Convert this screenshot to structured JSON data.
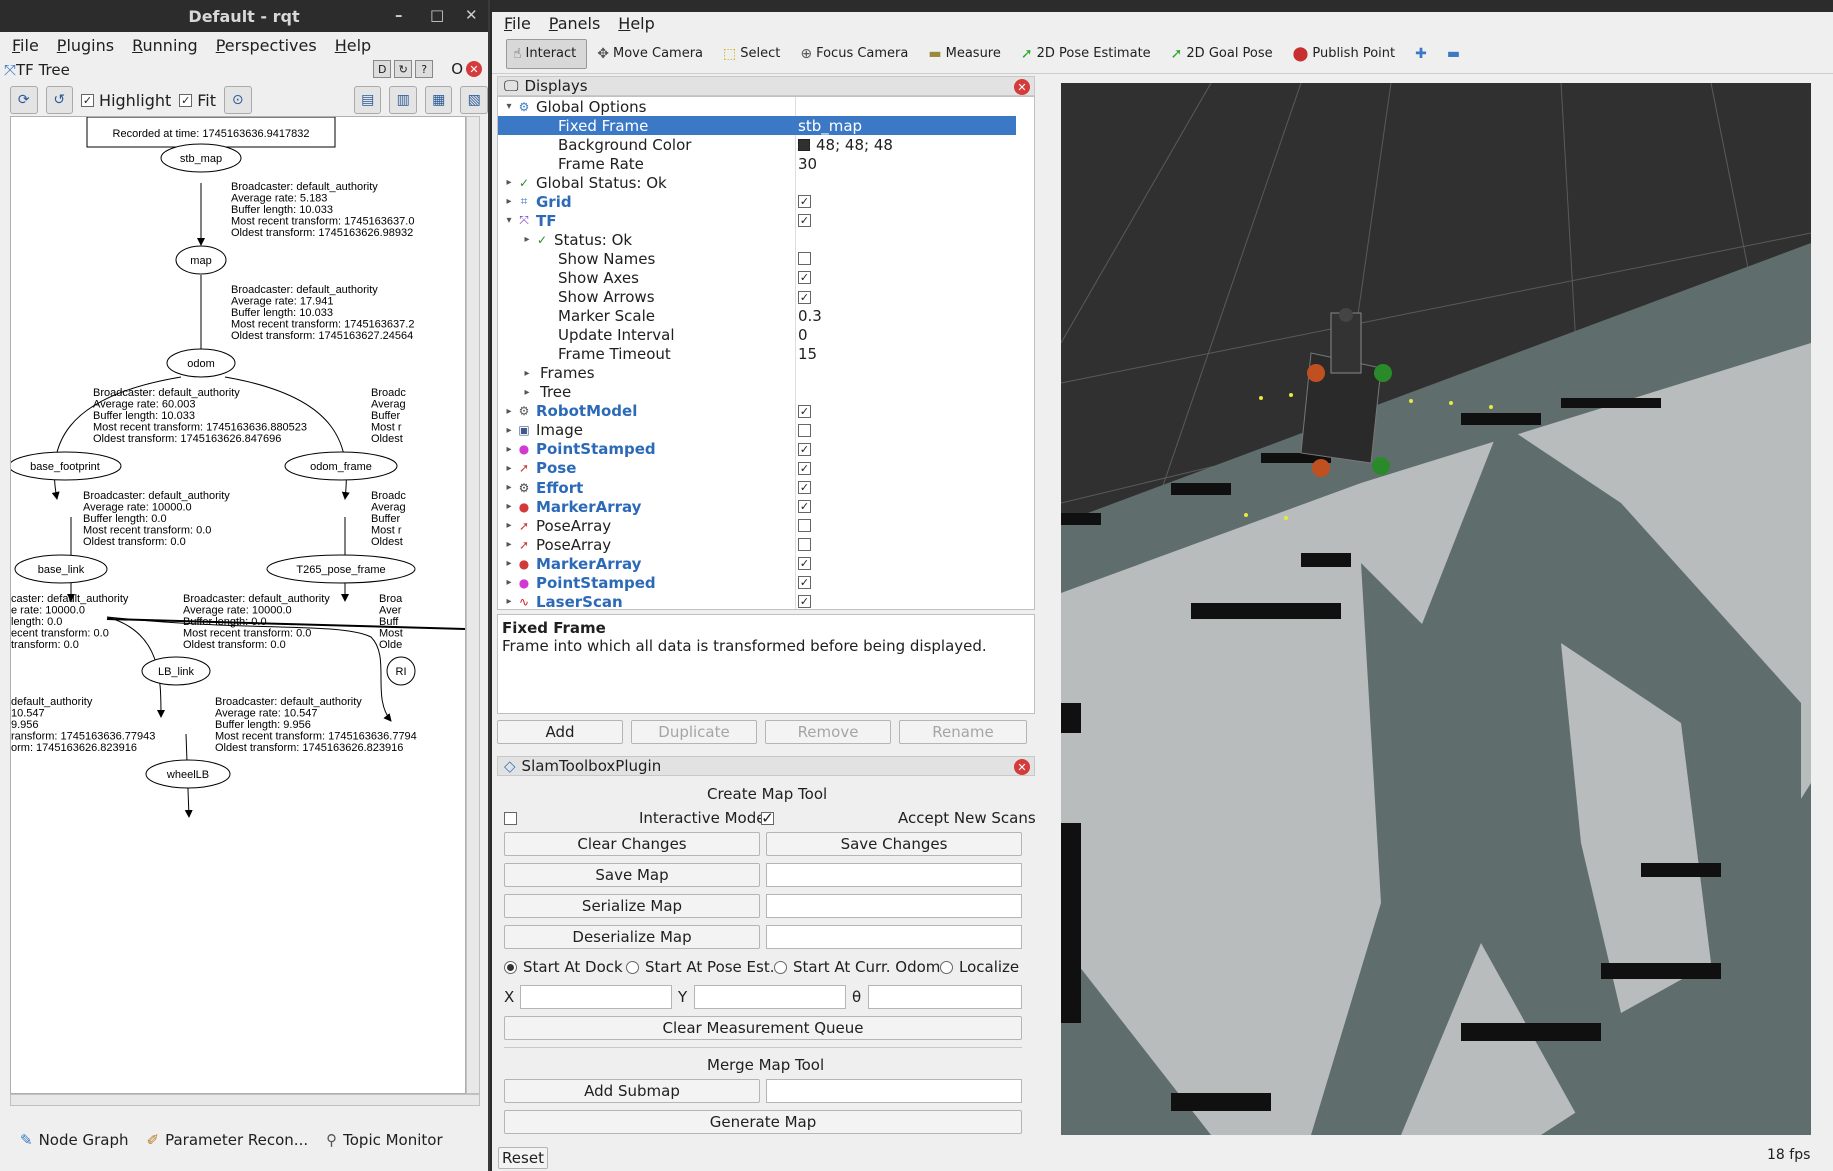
{
  "rqt": {
    "title": "Default - rqt",
    "window_controls": [
      "–",
      "□",
      "✕"
    ],
    "menu": [
      "File",
      "Plugins",
      "Running",
      "Perspectives",
      "Help"
    ],
    "plugin_title": "TF Tree",
    "plugin_ctl": [
      "D",
      "O"
    ],
    "toolbar": {
      "highlight_label": "Highlight",
      "fit_label": "Fit"
    },
    "tf_tree": {
      "recorded": "Recorded at time: 1745163636.9417832",
      "nodes": [
        "stb_map",
        "map",
        "odom",
        "base_footprint",
        "odom_frame",
        "base_link",
        "T265_pose_frame",
        "LB_link",
        "RI",
        "wheelLB"
      ],
      "edge_labels": [
        [
          "Broadcaster: default_authority",
          "Average rate: 5.183",
          "Buffer length: 10.033",
          "Most recent transform: 1745163637.0",
          "Oldest transform: 1745163626.98932"
        ],
        [
          "Broadcaster: default_authority",
          "Average rate: 17.941",
          "Buffer length: 10.033",
          "Most recent transform: 1745163637.2",
          "Oldest transform: 1745163627.24564"
        ],
        [
          "Broadcaster: default_authority",
          "Average rate: 60.003",
          "Buffer length: 10.033",
          "Most recent transform: 1745163636.880523",
          "Oldest transform: 1745163626.847696"
        ],
        [
          "Broadc",
          "Averag",
          "Buffer",
          "Most r",
          "Oldest"
        ],
        [
          "Broadcaster: default_authority",
          "Average rate: 10000.0",
          "Buffer length: 0.0",
          "Most recent transform: 0.0",
          "Oldest transform: 0.0"
        ],
        [
          "Broadc",
          "Averag",
          "Buffer",
          "Most r",
          "Oldest"
        ],
        [
          "caster: default_authority",
          "e rate: 10000.0",
          "length: 0.0",
          "ecent transform: 0.0",
          "transform: 0.0"
        ],
        [
          "Broadcaster: default_authority",
          "Average rate: 10000.0",
          "Buffer length: 0.0",
          "Most recent transform: 0.0",
          "Oldest transform: 0.0"
        ],
        [
          "Broa",
          "Aver",
          "Buff",
          "Most",
          "Olde"
        ],
        [
          "default_authority",
          "10.547",
          "9.956",
          "ransform: 1745163636.77943",
          "orm: 1745163626.823916"
        ],
        [
          "Broadcaster: default_authority",
          "Average rate: 10.547",
          "Buffer length: 9.956",
          "Most recent transform: 1745163636.7794",
          "Oldest transform: 1745163626.823916"
        ]
      ]
    },
    "bottom_tabs": [
      {
        "icon": "node-graph-icon",
        "glyph": "✎",
        "label": "Node Graph"
      },
      {
        "icon": "parameter-icon",
        "glyph": "✐",
        "label": "Parameter Recon..."
      },
      {
        "icon": "topic-monitor-icon",
        "glyph": "⚲",
        "label": "Topic Monitor"
      }
    ]
  },
  "rviz": {
    "menu": [
      "File",
      "Panels",
      "Help"
    ],
    "tools": [
      {
        "label": "Interact",
        "glyph": "☝",
        "active": true
      },
      {
        "label": "Move Camera",
        "glyph": "✥",
        "active": false
      },
      {
        "label": "Select",
        "glyph": "⬚",
        "active": false
      },
      {
        "label": "Focus Camera",
        "glyph": "⊕",
        "active": false
      },
      {
        "label": "Measure",
        "glyph": "▬",
        "active": false
      },
      {
        "label": "2D Pose Estimate",
        "glyph": "➚",
        "active": false
      },
      {
        "label": "2D Goal Pose",
        "glyph": "➚",
        "active": false
      },
      {
        "label": "Publish Point",
        "glyph": "⬤",
        "active": false
      },
      {
        "label": "",
        "glyph": "✚",
        "active": false
      },
      {
        "label": "",
        "glyph": "▬",
        "active": false
      }
    ],
    "tool_colors": [
      "#555555",
      "#555555",
      "#c8a800",
      "#555555",
      "#9a8a40",
      "#2aa82a",
      "#2aa82a",
      "#c83030",
      "#3b79c6",
      "#3b79c6"
    ],
    "displays": {
      "title": "Displays",
      "rows": [
        {
          "label": "Global Options",
          "value": "",
          "arrow": "▾",
          "icon": "⚙",
          "indent": 0,
          "style": "",
          "check": null
        },
        {
          "label": "Fixed Frame",
          "value": "stb_map",
          "arrow": "",
          "icon": "",
          "indent": 2,
          "style": "selected",
          "check": null
        },
        {
          "label": "Background Color",
          "value": "48; 48; 48",
          "arrow": "",
          "icon": "",
          "indent": 2,
          "style": "",
          "check": null,
          "swatch": true
        },
        {
          "label": "Frame Rate",
          "value": "30",
          "arrow": "",
          "icon": "",
          "indent": 2,
          "style": "",
          "check": null
        },
        {
          "label": "Global Status: Ok",
          "value": "",
          "arrow": "▸",
          "icon": "✓",
          "indent": 0,
          "style": "",
          "check": null
        },
        {
          "label": "Grid",
          "value": "",
          "arrow": "▸",
          "icon": "⌗",
          "indent": 0,
          "style": "blue",
          "check": true
        },
        {
          "label": "TF",
          "value": "",
          "arrow": "▾",
          "icon": "⤧",
          "indent": 0,
          "style": "blue",
          "check": true
        },
        {
          "label": "Status: Ok",
          "value": "",
          "arrow": "▸",
          "icon": "✓",
          "indent": 1,
          "style": "",
          "check": null
        },
        {
          "label": "Show Names",
          "value": "",
          "arrow": "",
          "icon": "",
          "indent": 2,
          "style": "",
          "check": false
        },
        {
          "label": "Show Axes",
          "value": "",
          "arrow": "",
          "icon": "",
          "indent": 2,
          "style": "",
          "check": true
        },
        {
          "label": "Show Arrows",
          "value": "",
          "arrow": "",
          "icon": "",
          "indent": 2,
          "style": "",
          "check": true
        },
        {
          "label": "Marker Scale",
          "value": "0.3",
          "arrow": "",
          "icon": "",
          "indent": 2,
          "style": "",
          "check": null
        },
        {
          "label": "Update Interval",
          "value": "0",
          "arrow": "",
          "icon": "",
          "indent": 2,
          "style": "",
          "check": null
        },
        {
          "label": "Frame Timeout",
          "value": "15",
          "arrow": "",
          "icon": "",
          "indent": 2,
          "style": "",
          "check": null
        },
        {
          "label": "Frames",
          "value": "",
          "arrow": "▸",
          "icon": "",
          "indent": 1,
          "style": "",
          "check": null
        },
        {
          "label": "Tree",
          "value": "",
          "arrow": "▸",
          "icon": "",
          "indent": 1,
          "style": "",
          "check": null
        },
        {
          "label": "RobotModel",
          "value": "",
          "arrow": "▸",
          "icon": "⚙",
          "indent": 0,
          "style": "blue",
          "check": true
        },
        {
          "label": "Image",
          "value": "",
          "arrow": "▸",
          "icon": "▣",
          "indent": 0,
          "style": "",
          "check": false
        },
        {
          "label": "PointStamped",
          "value": "",
          "arrow": "▸",
          "icon": "●",
          "indent": 0,
          "style": "blue",
          "check": true
        },
        {
          "label": "Pose",
          "value": "",
          "arrow": "▸",
          "icon": "➚",
          "indent": 0,
          "style": "blue",
          "check": true
        },
        {
          "label": "Effort",
          "value": "",
          "arrow": "▸",
          "icon": "⚙",
          "indent": 0,
          "style": "blue",
          "check": true
        },
        {
          "label": "MarkerArray",
          "value": "",
          "arrow": "▸",
          "icon": "●",
          "indent": 0,
          "style": "blue",
          "check": true
        },
        {
          "label": "PoseArray",
          "value": "",
          "arrow": "▸",
          "icon": "➚",
          "indent": 0,
          "style": "",
          "check": false
        },
        {
          "label": "PoseArray",
          "value": "",
          "arrow": "▸",
          "icon": "➚",
          "indent": 0,
          "style": "",
          "check": false
        },
        {
          "label": "MarkerArray",
          "value": "",
          "arrow": "▸",
          "icon": "●",
          "indent": 0,
          "style": "blue",
          "check": true
        },
        {
          "label": "PointStamped",
          "value": "",
          "arrow": "▸",
          "icon": "●",
          "indent": 0,
          "style": "blue",
          "check": true
        },
        {
          "label": "LaserScan",
          "value": "",
          "arrow": "▸",
          "icon": "∿",
          "indent": 0,
          "style": "blue",
          "check": true
        }
      ],
      "icon_colors": [
        "#3b79c6",
        "#000000",
        "#000000",
        "#000000",
        "#2a8a2a",
        "#3b79c6",
        "#7a3ac6",
        "#2a8a2a",
        "#000",
        "#000",
        "#000",
        "#000",
        "#000",
        "#000",
        "#000",
        "#000",
        "#555555",
        "#3b5a8a",
        "#d23ad2",
        "#d23a3a",
        "#444444",
        "#d23a3a",
        "#d23a3a",
        "#d23a3a",
        "#d23a3a",
        "#d23ad2",
        "#c82020"
      ],
      "desc_title": "Fixed Frame",
      "desc_text": "Frame into which all data is transformed before being displayed.",
      "buttons": [
        "Add",
        "Duplicate",
        "Remove",
        "Rename"
      ]
    },
    "slam": {
      "title": "SlamToolboxPlugin",
      "create_title": "Create Map Tool",
      "interactive_mode": "Interactive Mode",
      "accept_new_scans": "Accept New Scans",
      "clear_changes": "Clear Changes",
      "save_changes": "Save Changes",
      "save_map": "Save Map",
      "serialize_map": "Serialize Map",
      "deserialize_map": "Deserialize Map",
      "radios": [
        "Start At Dock",
        "Start At Pose Est.",
        "Start At Curr. Odom",
        "Localize"
      ],
      "x_label": "X",
      "y_label": "Y",
      "theta_label": "θ",
      "clear_queue": "Clear Measurement Queue",
      "merge_title": "Merge Map Tool",
      "add_submap": "Add Submap",
      "generate_map": "Generate Map"
    },
    "reset": "Reset",
    "fps": "18 fps",
    "bg_color": "#303030"
  }
}
